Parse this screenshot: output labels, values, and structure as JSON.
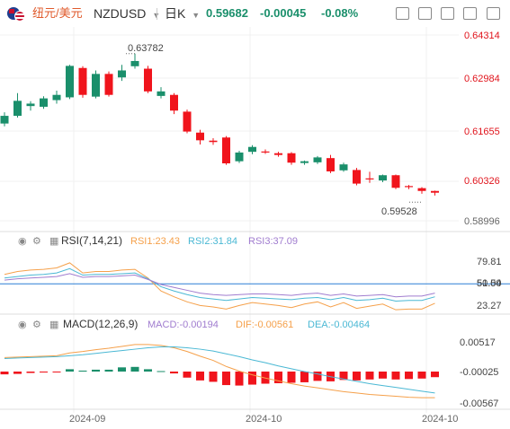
{
  "header": {
    "pair_name": "纽元/美元",
    "symbol": "NZDUSD",
    "timeframe": "日K",
    "last_price": "0.59682",
    "change": "-0.00045",
    "change_pct": "-0.08%"
  },
  "colors": {
    "up": "#1a8f6b",
    "down": "#f0141c",
    "rsi1": "#f5a04a",
    "rsi2": "#4ab8d4",
    "rsi3": "#a07ccf",
    "macd": "#a07ccf",
    "dif": "#f5a04a",
    "dea": "#4ab8d4",
    "hline": "#2b7fd6"
  },
  "chart_data": [
    {
      "type": "candlestick",
      "title": "NZDUSD",
      "x_labels": [
        "2024-09",
        "2024-10",
        "2024-10"
      ],
      "y_ticks": [
        "0.64314",
        "0.62984",
        "0.61655",
        "0.60326",
        "0.58996"
      ],
      "ylim": [
        0.58996,
        0.64314
      ],
      "annotations": {
        "high": "0.63782",
        "low": "0.59528"
      },
      "candles": [
        [
          0.6178,
          0.62,
          0.617,
          0.621
        ],
        [
          0.62,
          0.6243,
          0.6195,
          0.6265
        ],
        [
          0.6228,
          0.6235,
          0.6215,
          0.6242
        ],
        [
          0.6226,
          0.625,
          0.622,
          0.6256
        ],
        [
          0.6245,
          0.626,
          0.6235,
          0.6272
        ],
        [
          0.6253,
          0.6343,
          0.6248,
          0.6346
        ],
        [
          0.6337,
          0.626,
          0.6252,
          0.6342
        ],
        [
          0.6255,
          0.632,
          0.625,
          0.633
        ],
        [
          0.632,
          0.626,
          0.6255,
          0.6327
        ],
        [
          0.631,
          0.633,
          0.63,
          0.6346
        ],
        [
          0.6342,
          0.6357,
          0.6335,
          0.6378
        ],
        [
          0.6335,
          0.627,
          0.6265,
          0.6343
        ],
        [
          0.6257,
          0.627,
          0.625,
          0.6282
        ],
        [
          0.626,
          0.6215,
          0.6205,
          0.6265
        ],
        [
          0.6212,
          0.6155,
          0.615,
          0.6218
        ],
        [
          0.6152,
          0.613,
          0.6118,
          0.616
        ],
        [
          0.6129,
          0.6125,
          0.6117,
          0.6136
        ],
        [
          0.6138,
          0.6064,
          0.606,
          0.6142
        ],
        [
          0.607,
          0.6095,
          0.6065,
          0.61
        ],
        [
          0.6097,
          0.6111,
          0.609,
          0.6116
        ],
        [
          0.6098,
          0.6096,
          0.6091,
          0.6104
        ],
        [
          0.6093,
          0.6088,
          0.6083,
          0.6097
        ],
        [
          0.6093,
          0.6066,
          0.606,
          0.6096
        ],
        [
          0.6065,
          0.607,
          0.606,
          0.6072
        ],
        [
          0.6067,
          0.6081,
          0.6062,
          0.6085
        ],
        [
          0.6079,
          0.6041,
          0.6036,
          0.6088
        ],
        [
          0.6044,
          0.6061,
          0.604,
          0.6066
        ],
        [
          0.6045,
          0.6006,
          0.6001,
          0.6051
        ],
        [
          0.6021,
          0.602,
          0.6008,
          0.604
        ],
        [
          0.6015,
          0.603,
          0.601,
          0.6032
        ],
        [
          0.603,
          0.5994,
          0.599,
          0.6032
        ],
        [
          0.5999,
          0.5997,
          0.599,
          0.6002
        ],
        [
          0.5993,
          0.5985,
          0.5977,
          0.5996
        ],
        [
          0.5985,
          0.598,
          0.5972,
          0.5986
        ]
      ]
    },
    {
      "type": "line",
      "title": "RSI(7,14,21)",
      "series": [
        {
          "name": "RSI1:23.43",
          "values": [
            63,
            67,
            69,
            70,
            72,
            79,
            65,
            67,
            67,
            69,
            70,
            58,
            40,
            32,
            25,
            20,
            18,
            15,
            20,
            24,
            22,
            20,
            17,
            22,
            25,
            18,
            24,
            16,
            19,
            22,
            14,
            15,
            15,
            23
          ]
        },
        {
          "name": "RSI2:31.84",
          "values": [
            58,
            60,
            62,
            63,
            65,
            71,
            62,
            63,
            63,
            64,
            65,
            57,
            46,
            40,
            35,
            31,
            29,
            27,
            29,
            31,
            30,
            29,
            28,
            30,
            31,
            28,
            31,
            27,
            28,
            30,
            26,
            27,
            27,
            32
          ]
        },
        {
          "name": "RSI3:37.09",
          "values": [
            55,
            57,
            58,
            59,
            60,
            64,
            59,
            60,
            60,
            61,
            62,
            56,
            49,
            45,
            41,
            37,
            35,
            34,
            35,
            36,
            36,
            35,
            34,
            36,
            37,
            34,
            36,
            33,
            34,
            35,
            32,
            33,
            33,
            37
          ]
        }
      ],
      "y_ticks": [
        "79.81",
        "50.00",
        "51.54",
        "23.27"
      ],
      "ylim": [
        8,
        95
      ]
    },
    {
      "type": "bar",
      "title": "MACD(12,26,9)",
      "legend": [
        "MACD:-0.00194",
        "DIF:-0.00561",
        "DEA:-0.00464"
      ],
      "histogram": [
        -0.0006,
        -0.0005,
        -0.0003,
        -0.0002,
        -0.0001,
        0.0005,
        0.0002,
        0.0004,
        0.0004,
        0.0009,
        0.001,
        0.0005,
        0.0001,
        -0.0004,
        -0.0013,
        -0.0019,
        -0.0022,
        -0.0029,
        -0.003,
        -0.0028,
        -0.0026,
        -0.0025,
        -0.0024,
        -0.0023,
        -0.002,
        -0.0021,
        -0.0018,
        -0.0019,
        -0.0017,
        -0.0015,
        -0.0017,
        -0.0016,
        -0.0015,
        -0.0012
      ],
      "dif": [
        0.003,
        0.0031,
        0.0032,
        0.0033,
        0.0034,
        0.004,
        0.0043,
        0.0047,
        0.005,
        0.0054,
        0.0058,
        0.0058,
        0.0056,
        0.0051,
        0.0043,
        0.0033,
        0.0024,
        0.0011,
        0.0001,
        -0.0007,
        -0.0014,
        -0.002,
        -0.0026,
        -0.0031,
        -0.0035,
        -0.0039,
        -0.0043,
        -0.0046,
        -0.0049,
        -0.0051,
        -0.0053,
        -0.0055,
        -0.0056,
        -0.0056
      ],
      "dea": [
        0.0028,
        0.0029,
        0.003,
        0.0031,
        0.0032,
        0.0034,
        0.0036,
        0.0039,
        0.0042,
        0.0045,
        0.0048,
        0.0051,
        0.0053,
        0.0053,
        0.0051,
        0.0048,
        0.0044,
        0.0038,
        0.0032,
        0.0025,
        0.0019,
        0.0012,
        0.0006,
        0.0,
        -0.0005,
        -0.0011,
        -0.0016,
        -0.0021,
        -0.0026,
        -0.003,
        -0.0034,
        -0.0038,
        -0.0042,
        -0.0046
      ],
      "y_ticks": [
        "0.00517",
        "-0.00025",
        "-0.00567"
      ],
      "ylim": [
        -0.0077,
        0.0077
      ]
    }
  ]
}
